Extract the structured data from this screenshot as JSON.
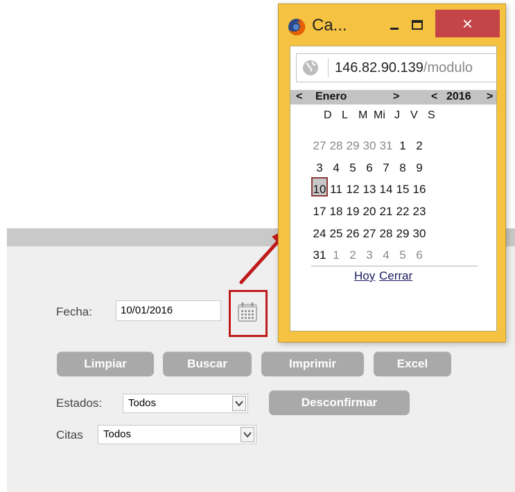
{
  "form": {
    "fecha_label": "Fecha:",
    "fecha_value": "10/01/2016",
    "estados_label": "Estados:",
    "estados_value": "Todos",
    "citas_label": "Citas",
    "citas_value": "Todos"
  },
  "buttons": {
    "limpiar": "Limpiar",
    "buscar": "Buscar",
    "imprimir": "Imprimir",
    "excel": "Excel",
    "desconfirmar": "Desconfirmar"
  },
  "popup": {
    "title": "Ca...",
    "close_glyph": "×",
    "url_host": "146.82.90.139",
    "url_path": "/modulo"
  },
  "calendar": {
    "prev_month": "<",
    "month": "Enero",
    "next_month": ">",
    "prev_year": "<",
    "year": "2016",
    "next_year": ">",
    "weekdays": [
      "D",
      "L",
      "M",
      "Mi",
      "J",
      "V",
      "S"
    ],
    "weeks": [
      [
        "27",
        "28",
        "29",
        "30",
        "31",
        "1",
        "2"
      ],
      [
        "3",
        "4",
        "5",
        "6",
        "7",
        "8",
        "9"
      ],
      [
        "10",
        "11",
        "12",
        "13",
        "14",
        "15",
        "16"
      ],
      [
        "17",
        "18",
        "19",
        "20",
        "21",
        "22",
        "23"
      ],
      [
        "24",
        "25",
        "26",
        "27",
        "28",
        "29",
        "30"
      ],
      [
        "31",
        "1",
        "2",
        "3",
        "4",
        "5",
        "6"
      ]
    ],
    "today_link": "Hoy",
    "close_link": "Cerrar"
  },
  "colors": {
    "popup_frame": "#f5c242",
    "close_button": "#c54448",
    "button_gray": "#a9a9a9",
    "highlight_red": "#c01b1b"
  }
}
